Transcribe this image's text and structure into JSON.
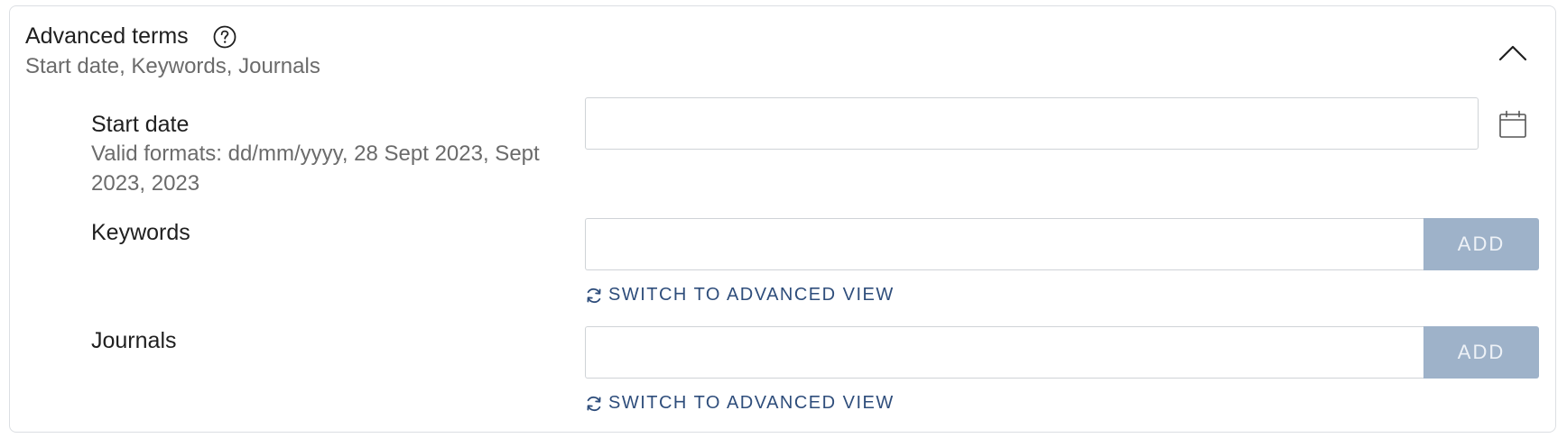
{
  "header": {
    "title": "Advanced terms",
    "subtitle": "Start date, Keywords, Journals"
  },
  "fields": {
    "start_date": {
      "label": "Start date",
      "hint": "Valid formats: dd/mm/yyyy, 28 Sept 2023, Sept 2023, 2023",
      "value": ""
    },
    "keywords": {
      "label": "Keywords",
      "value": "",
      "add_label": "ADD",
      "switch_label": "SWITCH TO ADVANCED VIEW"
    },
    "journals": {
      "label": "Journals",
      "value": "",
      "add_label": "ADD",
      "switch_label": "SWITCH TO ADVANCED VIEW"
    }
  },
  "icons": {
    "help": "help-icon",
    "collapse": "chevron-up-icon",
    "calendar": "calendar-icon",
    "switch": "refresh-icon"
  },
  "colors": {
    "add_button_bg": "#9eb2c9",
    "link": "#2e4d7b",
    "border": "#dcdfe3"
  }
}
